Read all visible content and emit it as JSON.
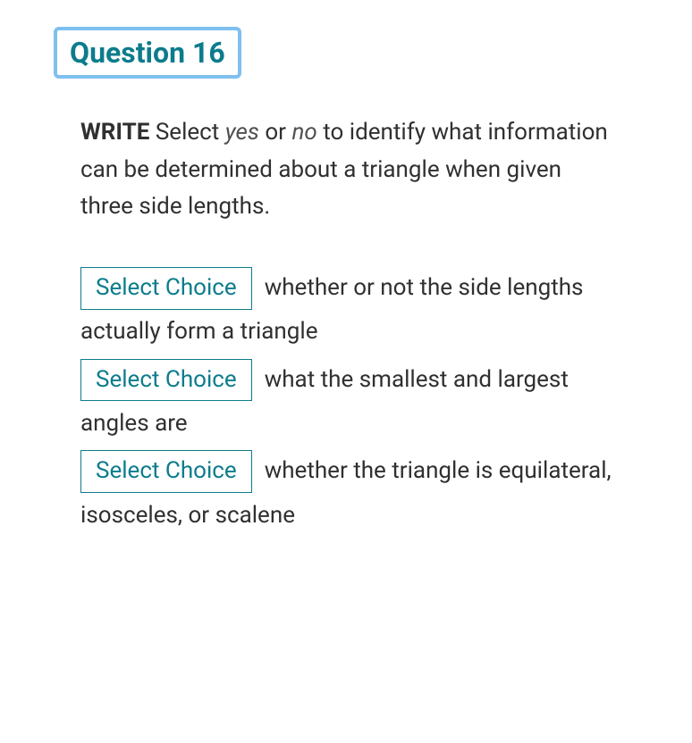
{
  "header": {
    "title": "Question 16"
  },
  "prompt": {
    "strong": "WRITE",
    "text_before_yes": " Select ",
    "yes": "yes",
    "text_between": " or ",
    "no": "no",
    "text_after": " to identify what information can be determined about a triangle when given three side lengths."
  },
  "select_label": "Select Choice",
  "choices": [
    {
      "text": "whether or not the side lengths actually form a triangle"
    },
    {
      "text": "what the smallest and largest angles are"
    },
    {
      "text": "whether the triangle is equilateral, isosceles, or scalene"
    }
  ]
}
